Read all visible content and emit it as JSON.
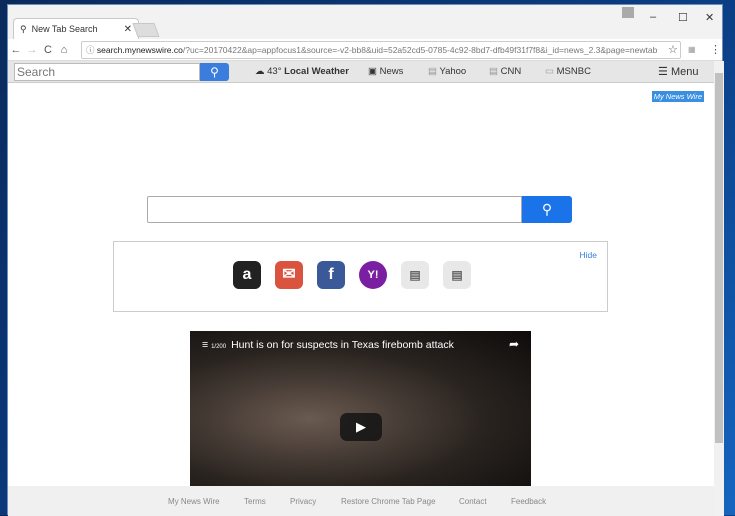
{
  "tab": {
    "title": "New Tab Search"
  },
  "address": {
    "domain": "search.mynewswire.co",
    "path": "/?uc=20170422&ap=appfocus1&source=-v2-bb8&uid=52a52cd5-0785-4c92-8bd7-dfb49f31f7f8&i_id=news_2.3&page=newtab"
  },
  "toolbar": {
    "search_placeholder": "Search",
    "temp": "43°",
    "weather": "Local Weather",
    "links": [
      "News",
      "Yahoo",
      "CNN",
      "MSNBC"
    ],
    "menu": "Menu"
  },
  "brand": "My News Wire",
  "shortcuts": {
    "hide": "Hide",
    "items": [
      "amazon",
      "gmail",
      "facebook",
      "yahoo",
      "news-1",
      "news-2"
    ]
  },
  "video": {
    "counter": "1/200",
    "title": "Hunt is on for suspects in Texas firebomb attack"
  },
  "footer": [
    "My News Wire",
    "Terms",
    "Privacy",
    "Restore Chrome Tab Page",
    "Contact",
    "Feedback"
  ],
  "colors": {
    "accent": "#1a73e8",
    "toolbar_button": "#3b7ddd"
  }
}
